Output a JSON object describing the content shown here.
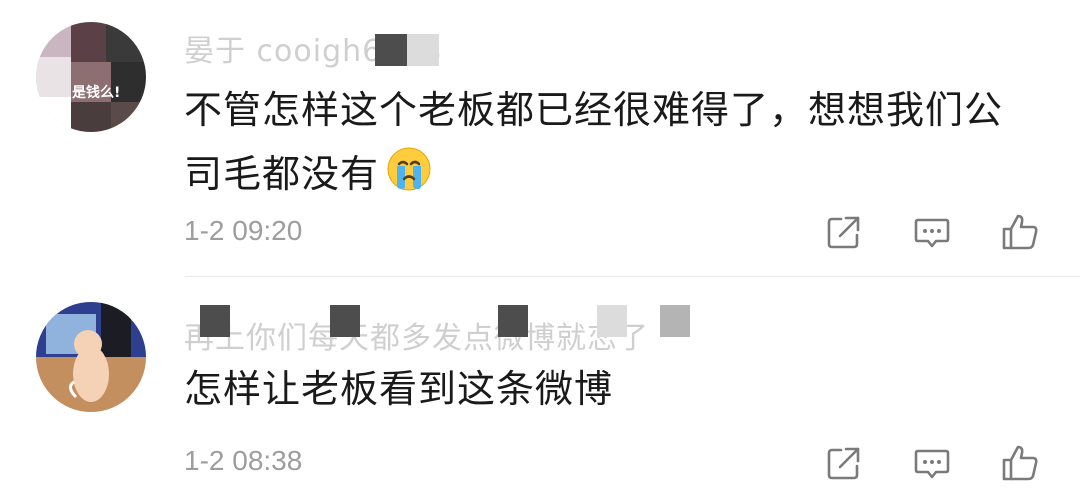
{
  "comments": [
    {
      "username": "晏于 cooigh6868",
      "avatar_text": "是钱么!",
      "text_line_1": "不管怎样这个老板都已经很难得了，想想我们公",
      "text_line_2": "司毛都没有",
      "emoji": "crying-face",
      "timestamp": "1-2 09:20"
    },
    {
      "username": "再上你们每天都多发点微博就恋了",
      "text_line_1": "怎样让老板看到这条微博",
      "timestamp": "1-2 08:38"
    }
  ],
  "actions": {
    "share_icon": "share-icon",
    "reply_icon": "comment-icon",
    "like_icon": "thumbs-up-icon"
  },
  "colors": {
    "text": "#1a1a1a",
    "meta": "#9d9d9d",
    "icon": "#7a7a7a",
    "divider": "#e9e9e9"
  }
}
